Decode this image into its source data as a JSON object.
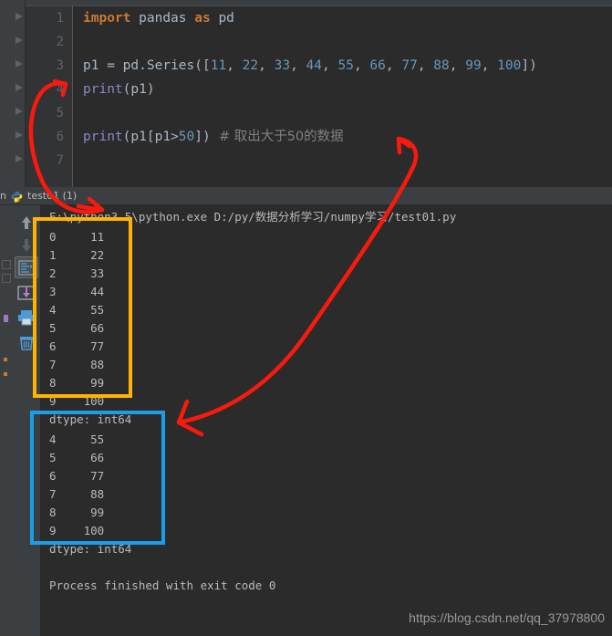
{
  "window": {
    "theme_bg": "#2b2b2b",
    "panel_bg": "#3c3f41"
  },
  "editor": {
    "line_numbers": [
      "1",
      "2",
      "3",
      "4",
      "5",
      "6",
      "7"
    ],
    "lines": [
      {
        "n": "1",
        "tokens": [
          {
            "t": "import",
            "c": "kw"
          },
          {
            "t": " ",
            "c": "pun"
          },
          {
            "t": "pandas",
            "c": "id"
          },
          {
            "t": " ",
            "c": "pun"
          },
          {
            "t": "as",
            "c": "kw"
          },
          {
            "t": " ",
            "c": "pun"
          },
          {
            "t": "pd",
            "c": "id"
          }
        ]
      },
      {
        "n": "2",
        "tokens": []
      },
      {
        "n": "3",
        "tokens": [
          {
            "t": "p1 ",
            "c": "id"
          },
          {
            "t": "= ",
            "c": "pun"
          },
          {
            "t": "pd",
            "c": "id"
          },
          {
            "t": ".",
            "c": "pun"
          },
          {
            "t": "Series",
            "c": "id"
          },
          {
            "t": "([",
            "c": "pun"
          },
          {
            "t": "11",
            "c": "num"
          },
          {
            "t": ", ",
            "c": "pun"
          },
          {
            "t": "22",
            "c": "num"
          },
          {
            "t": ", ",
            "c": "pun"
          },
          {
            "t": "33",
            "c": "num"
          },
          {
            "t": ", ",
            "c": "pun"
          },
          {
            "t": "44",
            "c": "num"
          },
          {
            "t": ", ",
            "c": "pun"
          },
          {
            "t": "55",
            "c": "num"
          },
          {
            "t": ", ",
            "c": "pun"
          },
          {
            "t": "66",
            "c": "num"
          },
          {
            "t": ", ",
            "c": "pun"
          },
          {
            "t": "77",
            "c": "num"
          },
          {
            "t": ", ",
            "c": "pun"
          },
          {
            "t": "88",
            "c": "num"
          },
          {
            "t": ", ",
            "c": "pun"
          },
          {
            "t": "99",
            "c": "num"
          },
          {
            "t": ", ",
            "c": "pun"
          },
          {
            "t": "100",
            "c": "num"
          },
          {
            "t": "])",
            "c": "pun"
          }
        ]
      },
      {
        "n": "4",
        "tokens": [
          {
            "t": "print",
            "c": "fn"
          },
          {
            "t": "(",
            "c": "pun"
          },
          {
            "t": "p1",
            "c": "id"
          },
          {
            "t": ")",
            "c": "pun"
          }
        ]
      },
      {
        "n": "5",
        "tokens": []
      },
      {
        "n": "6",
        "tokens": [
          {
            "t": "print",
            "c": "fn"
          },
          {
            "t": "(",
            "c": "pun"
          },
          {
            "t": "p1",
            "c": "id"
          },
          {
            "t": "[",
            "c": "pun"
          },
          {
            "t": "p1",
            "c": "id"
          },
          {
            "t": ">",
            "c": "pun"
          },
          {
            "t": "50",
            "c": "num"
          },
          {
            "t": "])",
            "c": "pun"
          },
          {
            "t": "  # 取出大于50的数据",
            "c": "cmt"
          }
        ]
      },
      {
        "n": "7",
        "tokens": []
      }
    ],
    "plain_lines": [
      "import pandas as pd",
      "",
      "p1 = pd.Series([11, 22, 33, 44, 55, 66, 77, 88, 99, 100])",
      "print(p1)",
      "",
      "print(p1[p1>50])  # 取出大于50的数据",
      ""
    ]
  },
  "run_tab": {
    "tool_window_label": "n",
    "tab_name": "test01 (1)",
    "python_icon": "python-icon"
  },
  "console_toolbar": {
    "icons": [
      {
        "name": "arrow-up-icon",
        "label": "Up the stack trace"
      },
      {
        "name": "arrow-down-icon",
        "label": "Down the stack trace"
      },
      {
        "name": "soft-wrap-icon",
        "label": "Use Soft Wraps"
      },
      {
        "name": "export-icon",
        "label": "Export to Text File"
      },
      {
        "name": "print-icon",
        "label": "Print"
      },
      {
        "name": "trash-icon",
        "label": "Clear All"
      }
    ]
  },
  "console": {
    "command_line": "E:\\python3.5\\python.exe D:/py/数据分析学习/numpy学习/test01.py",
    "output_block_1": [
      "0     11",
      "1     22",
      "2     33",
      "3     44",
      "4     55",
      "5     66",
      "6     77",
      "7     88",
      "8     99",
      "9    100"
    ],
    "dtype_1": "dtype: int64",
    "output_block_2": [
      "4     55",
      "5     66",
      "6     77",
      "7     88",
      "8     99",
      "9    100"
    ],
    "dtype_2": "dtype: int64",
    "exit_line": "Process finished with exit code 0"
  },
  "annotations": {
    "yellow_box": {
      "name": "yellow-highlight-box",
      "color": "#FFB400"
    },
    "blue_box": {
      "name": "blue-highlight-box",
      "color": "#189FE8"
    },
    "arrow_color": "#F91A0D",
    "arrow_1": "arrow-from-output1-to-print-p1",
    "arrow_2": "arrow-from-output2-to-filter-comment"
  },
  "watermark": {
    "text": "https://blog.csdn.net/qq_37978800"
  }
}
